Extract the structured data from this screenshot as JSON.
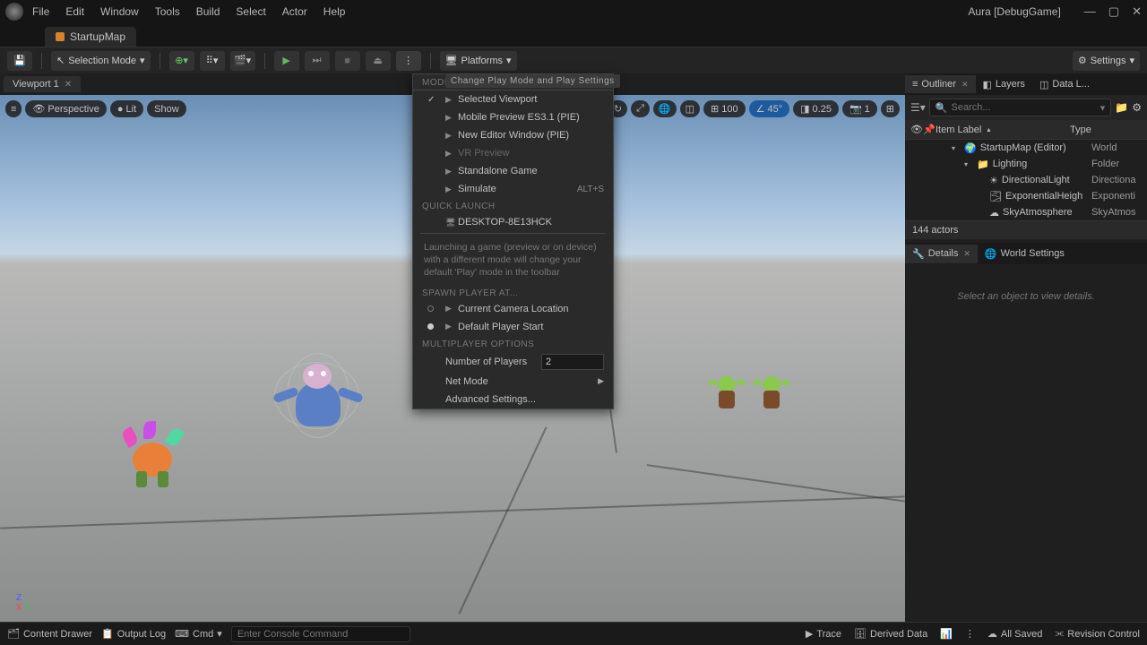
{
  "menu": {
    "file": "File",
    "edit": "Edit",
    "window": "Window",
    "tools": "Tools",
    "build": "Build",
    "select": "Select",
    "actor": "Actor",
    "help": "Help"
  },
  "title": "Aura [DebugGame]",
  "map_tab": "StartupMap",
  "toolbar": {
    "selection_mode": "Selection Mode",
    "platforms": "Platforms",
    "settings": "Settings"
  },
  "viewport": {
    "tab": "Viewport 1",
    "perspective": "Perspective",
    "lit": "Lit",
    "show": "Show",
    "grid_size": "100",
    "angle": "45°",
    "scale": "0.25",
    "camera": "1"
  },
  "dropdown": {
    "tooltip": "Change Play Mode and Play Settings",
    "sec_modes": "MODES",
    "selected_viewport": "Selected Viewport",
    "mobile_preview": "Mobile Preview ES3.1 (PIE)",
    "new_editor": "New Editor Window (PIE)",
    "vr_preview": "VR Preview",
    "standalone": "Standalone Game",
    "simulate": "Simulate",
    "simulate_sc": "ALT+S",
    "sec_quick": "QUICK LAUNCH",
    "device": "DESKTOP-8E13HCK",
    "hint": "Launching a game (preview or on device) with a different mode will change your default 'Play' mode in the toolbar",
    "sec_spawn": "SPAWN PLAYER AT...",
    "cur_camera": "Current Camera Location",
    "default_start": "Default Player Start",
    "sec_multi": "MULTIPLAYER OPTIONS",
    "num_players_lbl": "Number of Players",
    "num_players_val": "2",
    "net_mode": "Net Mode",
    "advanced": "Advanced Settings..."
  },
  "outliner": {
    "tabs": {
      "outliner": "Outliner",
      "layers": "Layers",
      "datal": "Data L..."
    },
    "search_ph": "Search...",
    "col_item": "Item Label",
    "col_type": "Type",
    "rows": [
      {
        "indent": 1,
        "arrow": "▾",
        "icon": "world",
        "label": "StartupMap (Editor)",
        "type": "World"
      },
      {
        "indent": 2,
        "arrow": "▾",
        "icon": "folder",
        "label": "Lighting",
        "type": "Folder"
      },
      {
        "indent": 3,
        "arrow": "",
        "icon": "light",
        "label": "DirectionalLight",
        "type": "Directiona"
      },
      {
        "indent": 3,
        "arrow": "",
        "icon": "fog",
        "label": "ExponentialHeigh",
        "type": "Exponenti"
      },
      {
        "indent": 3,
        "arrow": "",
        "icon": "sky",
        "label": "SkyAtmosphere",
        "type": "SkyAtmos"
      }
    ],
    "footer": "144 actors"
  },
  "details": {
    "tabs": {
      "details": "Details",
      "world": "World Settings"
    },
    "empty": "Select an object to view details."
  },
  "bottom": {
    "content_drawer": "Content Drawer",
    "output_log": "Output Log",
    "cmd": "Cmd",
    "cmd_ph": "Enter Console Command",
    "trace": "Trace",
    "derived": "Derived Data",
    "saved": "All Saved",
    "revision": "Revision Control"
  }
}
